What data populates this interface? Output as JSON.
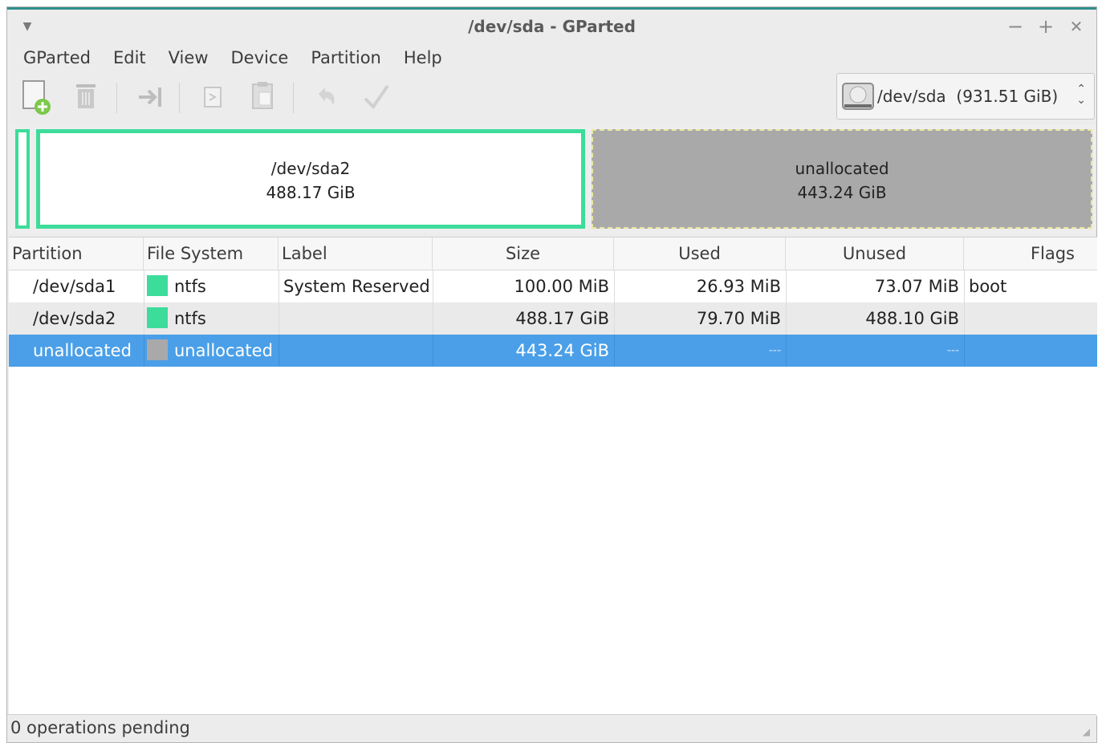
{
  "window": {
    "title": "/dev/sda - GParted",
    "controls": {
      "minimize": "−",
      "maximize": "+",
      "close": "✕"
    }
  },
  "menubar": [
    "GParted",
    "Edit",
    "View",
    "Device",
    "Partition",
    "Help"
  ],
  "toolbar": {
    "buttons": [
      "new-icon",
      "delete-icon",
      "resize-move-icon",
      "copy-icon",
      "paste-icon",
      "undo-icon",
      "apply-icon"
    ]
  },
  "device": {
    "name": "/dev/sda",
    "size": "(931.51 GiB)",
    "display": "/dev/sda  (931.51 GiB)"
  },
  "disk_map": {
    "sda2": {
      "name": "/dev/sda2",
      "size": "488.17 GiB"
    },
    "unallocated": {
      "name": "unallocated",
      "size": "443.24 GiB"
    }
  },
  "table": {
    "headers": [
      "Partition",
      "File System",
      "Label",
      "Size",
      "Used",
      "Unused",
      "Flags"
    ],
    "rows": [
      {
        "partition": "/dev/sda1",
        "fs": "ntfs",
        "fs_color": "#3ddc9b",
        "label": "System Reserved",
        "size": "100.00 MiB",
        "used": "26.93 MiB",
        "unused": "73.07 MiB",
        "flags": "boot"
      },
      {
        "partition": "/dev/sda2",
        "fs": "ntfs",
        "fs_color": "#3ddc9b",
        "label": "",
        "size": "488.17 GiB",
        "used": "79.70 MiB",
        "unused": "488.10 GiB",
        "flags": ""
      },
      {
        "partition": "unallocated",
        "fs": "unallocated",
        "fs_color": "#a9a9a9",
        "label": "",
        "size": "443.24 GiB",
        "used": "---",
        "unused": "---",
        "flags": ""
      }
    ]
  },
  "status": {
    "text": "0 operations pending"
  },
  "colors": {
    "ntfs": "#3ddc9b",
    "unallocated": "#a9a9a9",
    "selection": "#4a9fe8"
  }
}
